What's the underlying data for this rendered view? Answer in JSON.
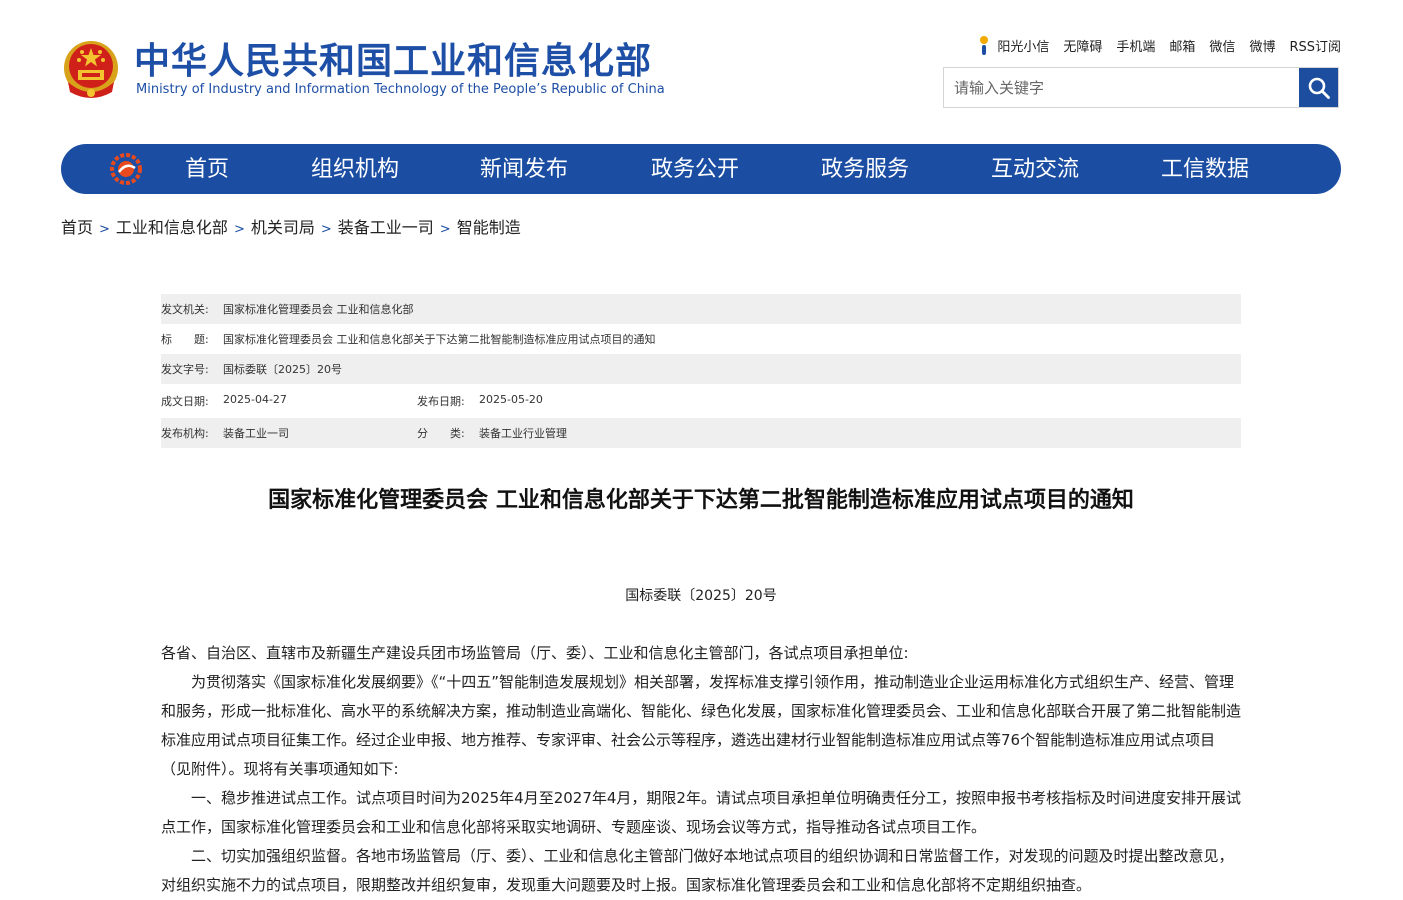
{
  "header": {
    "title_cn": "中华人民共和国工业和信息化部",
    "title_en": "Ministry of Industry and Information Technology of the People’s Republic of China",
    "top_links": [
      "阳光小信",
      "无障碍",
      "手机端",
      "邮箱",
      "微信",
      "微博",
      "RSS订阅"
    ],
    "search_placeholder": "请输入关键字"
  },
  "nav": {
    "items": [
      "首页",
      "组织机构",
      "新闻发布",
      "政务公开",
      "政务服务",
      "互动交流",
      "工信数据"
    ]
  },
  "breadcrumb": [
    "首页",
    "工业和信息化部",
    "机关司局",
    "装备工业一司",
    "智能制造"
  ],
  "meta": {
    "issuer_label": "发文机关:",
    "issuer": "国家标准化管理委员会 工业和信息化部",
    "title_label": "标　　题:",
    "title": "国家标准化管理委员会 工业和信息化部关于下达第二批智能制造标准应用试点项目的通知",
    "docno_label": "发文字号:",
    "docno": "国标委联〔2025〕20号",
    "created_label": "成文日期:",
    "created": "2025-04-27",
    "published_label": "发布日期:",
    "published": "2025-05-20",
    "org_label": "发布机构:",
    "org": "装备工业一司",
    "category_label": "分　　类:",
    "category": "装备工业行业管理"
  },
  "article": {
    "title": "国家标准化管理委员会 工业和信息化部关于下达第二批智能制造标准应用试点项目的通知",
    "docno": "国标委联〔2025〕20号",
    "salutation": "各省、自治区、直辖市及新疆生产建设兵团市场监管局（厅、委）、工业和信息化主管部门，各试点项目承担单位:",
    "paragraphs": [
      "为贯彻落实《国家标准化发展纲要》《“十四五”智能制造发展规划》相关部署，发挥标准支撑引领作用，推动制造业企业运用标准化方式组织生产、经营、管理和服务，形成一批标准化、高水平的系统解决方案，推动制造业高端化、智能化、绿色化发展，国家标准化管理委员会、工业和信息化部联合开展了第二批智能制造标准应用试点项目征集工作。经过企业申报、地方推荐、专家评审、社会公示等程序，遴选出建材行业智能制造标准应用试点等76个智能制造标准应用试点项目（见附件）。现将有关事项通知如下:",
      "一、稳步推进试点工作。试点项目时间为2025年4月至2027年4月，期限2年。请试点项目承担单位明确责任分工，按照申报书考核指标及时间进度安排开展试点工作，国家标准化管理委员会和工业和信息化部将采取实地调研、专题座谈、现场会议等方式，指导推动各试点项目工作。",
      "二、切实加强组织监督。各地市场监管局（厅、委）、工业和信息化主管部门做好本地试点项目的组织协调和日常监督工作，对发现的问题及时提出整改意见，对组织实施不力的试点项目，限期整改并组织复审，发现重大问题要及时上报。国家标准化管理委员会和工业和信息化部将不定期组织抽查。"
    ]
  }
}
